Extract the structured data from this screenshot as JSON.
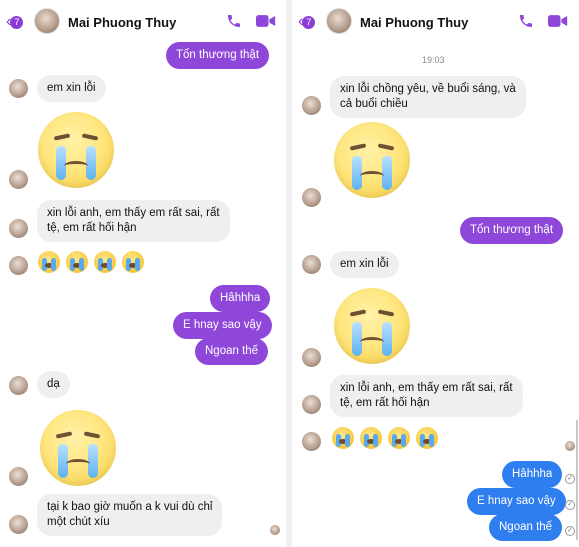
{
  "left": {
    "header": {
      "back_count": "7",
      "name": "Mai Phuong Thuy"
    },
    "messages": {
      "m1": "Tổn thương thật",
      "m2": "em xin lỗi",
      "m3_line1": "xin lỗi anh, em thấy em rất sai, rất",
      "m3_line2": "tệ, em rất hối hận",
      "m4": "Hâhhha",
      "m5": "E hnay sao vậy",
      "m6": "Ngoan thế",
      "m7": "dạ",
      "m8_line1": "tại k bao giờ muốn a k vui dù chỉ",
      "m8_line2": "một chút xíu"
    }
  },
  "right": {
    "header": {
      "back_count": "7",
      "name": "Mai Phuong Thuy"
    },
    "timestamp": "19:03",
    "messages": {
      "m1_line1": "xin lỗi chồng yêu, về buổi sáng, và",
      "m1_line2": "cả buổi chiều",
      "m2": "Tổn thương thật",
      "m3": "em xin lỗi",
      "m4_line1": "xin lỗi anh, em thấy em rất sai, rất",
      "m4_line2": "tệ, em rất hối hận",
      "m5": "Hâhhha",
      "m6": "E hnay sao vậy",
      "m7": "Ngoan thế"
    }
  },
  "icons": {
    "back": "chevron-left-icon",
    "call": "phone-icon",
    "video": "video-camera-icon",
    "sticker": "crying-face-sticker",
    "emoji": "loudly-crying-face-emoji",
    "read": "check-circle-icon"
  },
  "colors": {
    "accent_purple": "#8e47d9",
    "outgoing_blue": "#2f7ef0",
    "incoming_gray": "#efefef"
  }
}
